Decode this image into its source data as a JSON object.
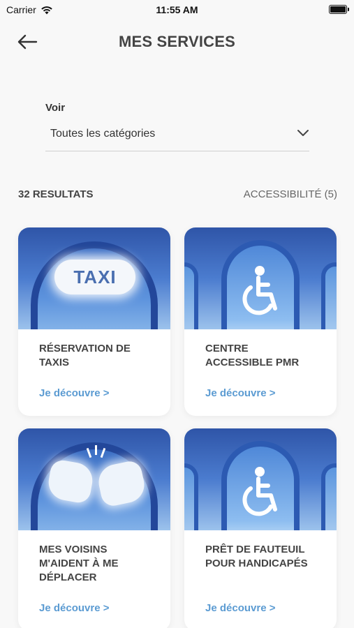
{
  "status": {
    "carrier": "Carrier",
    "time": "11:55 AM"
  },
  "header": {
    "title": "MES SERVICES"
  },
  "filter": {
    "label": "Voir",
    "value": "Toutes les catégories"
  },
  "results": {
    "count": "32 RESULTATS",
    "tag": "ACCESSIBILITÉ (5)"
  },
  "cards": [
    {
      "title": "RÉSERVATION DE TAXIS",
      "cta": "Je découvre >",
      "image_text": "TAXI"
    },
    {
      "title": "CENTRE ACCESSIBLE PMR",
      "cta": "Je découvre >"
    },
    {
      "title": "MES VOISINS M'AIDENT À ME DÉPLACER",
      "cta": "Je découvre >"
    },
    {
      "title": "PRÊT DE FAUTEUIL POUR HANDICAPÉS",
      "cta": "Je découvre >"
    }
  ],
  "icons": [
    "wifi-icon",
    "battery-icon",
    "back-arrow-icon",
    "chevron-down-icon",
    "wheelchair-icon"
  ]
}
